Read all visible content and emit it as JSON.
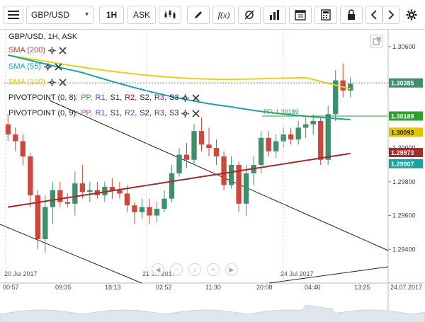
{
  "toolbar": {
    "symbol": "GBP/USD",
    "timeframe": "1H",
    "price_type": "ASK",
    "tools": [
      "menu-icon",
      "candle-style-icon",
      "draw-pencil-icon",
      "fx-indicator-icon",
      "crosshair-icon",
      "bar-chart-icon",
      "calendar-icon",
      "calculator-icon",
      "lock-icon",
      "arrow-left-icon",
      "arrow-right-icon",
      "settings-icon"
    ],
    "fx_label": "f(x)"
  },
  "chart": {
    "title": "GBP/USD, 1H, ASK",
    "indicators": [
      {
        "label": "SMA (200)",
        "color": "#c0392b"
      },
      {
        "label": "SMA (55)",
        "color": "#1aa3a3"
      },
      {
        "label": "SMA (100)",
        "color": "#e1c500"
      }
    ],
    "pivots": [
      {
        "label": "PIVOTPOINT (0, 8):",
        "levels": [
          "PP,",
          "R1,",
          "S1,",
          "R2,",
          "S2,",
          "R3,",
          "S3"
        ],
        "colors": [
          "#2ea02e",
          "#3a4fd1",
          "#222",
          "#b3002d",
          "#222",
          "#7a1fa2",
          "#222"
        ]
      },
      {
        "label": "PIVOTPOINT (0, 9):",
        "levels": [
          "PP,",
          "R1,",
          "S1,",
          "R2,",
          "S2,",
          "R3,",
          "S3"
        ],
        "colors": [
          "#d23ad2",
          "#3a4fd1",
          "#222",
          "#3a4fd1",
          "#222",
          "#7a1fa2",
          "#222"
        ]
      }
    ],
    "pp_label": "PP: 1.30189",
    "price_ticks": [
      "1.30600",
      "1.30200",
      "1.30000",
      "1.29800",
      "1.29600",
      "1.29400"
    ],
    "price_boxes": [
      {
        "label": "1.30385",
        "color": "#3f8f6a"
      },
      {
        "label": "1.30189",
        "color": "#2ea02e"
      },
      {
        "label": "1.30093",
        "color": "#e1c500"
      },
      {
        "label": "1.29973",
        "color": "#a52a2a"
      },
      {
        "label": "1.29907",
        "color": "#1aa3a3"
      }
    ],
    "time_ticks": [
      "00:57",
      "09:35",
      "18:13",
      "02:52",
      "11:30",
      "20:08",
      "04:46",
      "13:25",
      "24.07.2017"
    ],
    "date_labels": [
      "20 Jul 2017",
      "21 Jul 2017",
      "24 Jul 2017"
    ]
  },
  "chart_data": {
    "type": "candlestick",
    "symbol": "GBP/USD",
    "interval": "1H",
    "ylim": [
      1.292,
      1.307
    ],
    "candles": [
      [
        1.3014,
        1.302,
        1.3004,
        1.3008
      ],
      [
        1.3008,
        1.3012,
        1.2998,
        1.3004
      ],
      [
        1.3004,
        1.3008,
        1.299,
        1.2995
      ],
      [
        1.2995,
        1.2997,
        1.2965,
        1.2972
      ],
      [
        1.2972,
        1.2975,
        1.294,
        1.2946
      ],
      [
        1.2946,
        1.2972,
        1.2938,
        1.2965
      ],
      [
        1.2965,
        1.298,
        1.2955,
        1.2975
      ],
      [
        1.2975,
        1.298,
        1.2965,
        1.2968
      ],
      [
        1.2968,
        1.2973,
        1.2965,
        1.2967
      ],
      [
        1.2967,
        1.2986,
        1.296,
        1.2979
      ],
      [
        1.2979,
        1.299,
        1.297,
        1.2974
      ],
      [
        1.2974,
        1.298,
        1.2968,
        1.2975
      ],
      [
        1.2975,
        1.298,
        1.297,
        1.2972
      ],
      [
        1.2972,
        1.298,
        1.2968,
        1.2977
      ],
      [
        1.2977,
        1.2982,
        1.297,
        1.2975
      ],
      [
        1.2975,
        1.298,
        1.297,
        1.2973
      ],
      [
        1.2973,
        1.2978,
        1.2962,
        1.2966
      ],
      [
        1.2966,
        1.2968,
        1.2955,
        1.2962
      ],
      [
        1.2962,
        1.297,
        1.2958,
        1.2965
      ],
      [
        1.2965,
        1.297,
        1.2955,
        1.296
      ],
      [
        1.296,
        1.2968,
        1.2956,
        1.2964
      ],
      [
        1.2964,
        1.2975,
        1.2962,
        1.297
      ],
      [
        1.297,
        1.299,
        1.2968,
        1.2985
      ],
      [
        1.2985,
        1.3,
        1.2983,
        1.2996
      ],
      [
        1.2996,
        1.3003,
        1.2988,
        1.2993
      ],
      [
        1.2993,
        1.3014,
        1.299,
        1.301
      ],
      [
        1.301,
        1.3018,
        1.2998,
        1.3002
      ],
      [
        1.3002,
        1.3012,
        1.2995,
        1.3
      ],
      [
        1.3,
        1.3005,
        1.299,
        1.2995
      ],
      [
        1.2995,
        1.2998,
        1.2975,
        1.2978
      ],
      [
        1.2978,
        1.2995,
        1.2976,
        1.299
      ],
      [
        1.299,
        1.2992,
        1.2962,
        1.2967
      ],
      [
        1.2967,
        1.299,
        1.296,
        1.2985
      ],
      [
        1.2985,
        1.2995,
        1.2978,
        1.299
      ],
      [
        1.299,
        1.301,
        1.2985,
        1.3006
      ],
      [
        1.3006,
        1.301,
        1.2995,
        1.2998
      ],
      [
        1.2998,
        1.3008,
        1.2994,
        1.3004
      ],
      [
        1.3004,
        1.3012,
        1.3,
        1.3008
      ],
      [
        1.3008,
        1.3012,
        1.3002,
        1.3005
      ],
      [
        1.3005,
        1.3016,
        1.3002,
        1.3012
      ],
      [
        1.3012,
        1.3018,
        1.3006,
        1.3014
      ],
      [
        1.3014,
        1.302,
        1.3008,
        1.3016
      ],
      [
        1.3016,
        1.3018,
        1.299,
        1.2993
      ],
      [
        1.2993,
        1.3025,
        1.299,
        1.302
      ],
      [
        1.302,
        1.3046,
        1.3016,
        1.304
      ],
      [
        1.304,
        1.305,
        1.303,
        1.3034
      ],
      [
        1.3034,
        1.3042,
        1.303,
        1.3038
      ]
    ]
  }
}
